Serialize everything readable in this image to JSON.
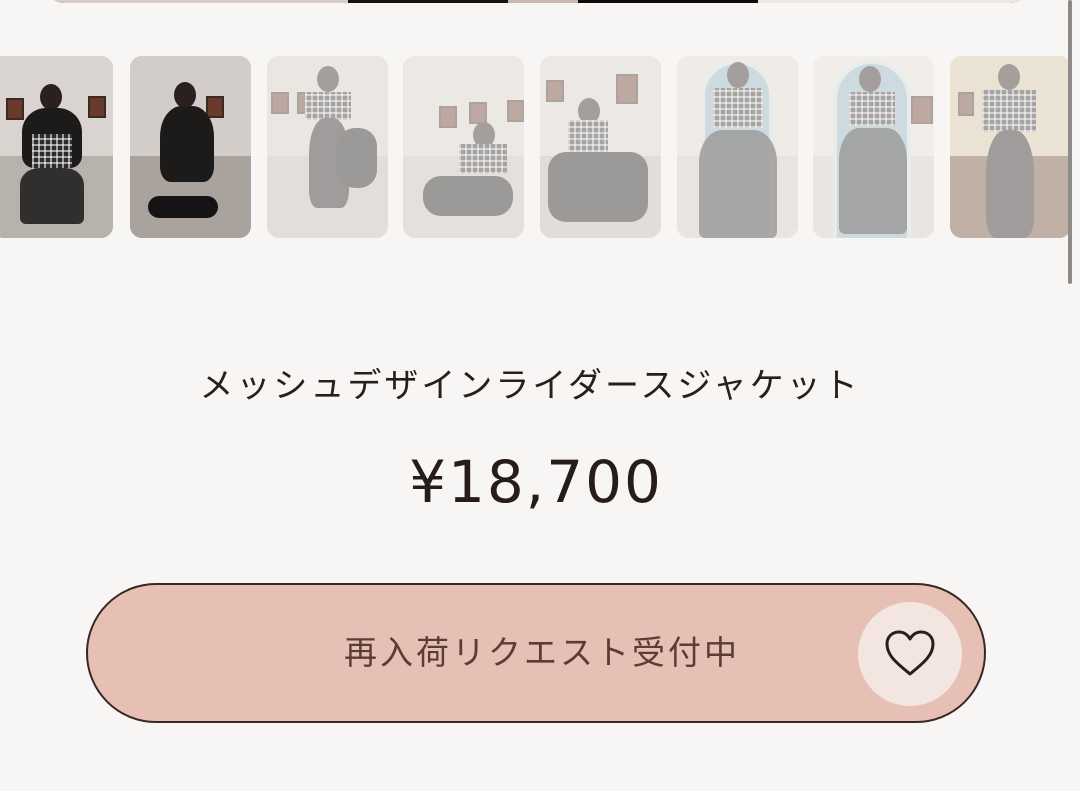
{
  "gallery": {
    "thumbnails": [
      {
        "id": "t1",
        "style": "studio-black-skirt"
      },
      {
        "id": "t2",
        "style": "studio-bag-pose"
      },
      {
        "id": "t3",
        "style": "studio-standing"
      },
      {
        "id": "t4",
        "style": "studio-lounge-chair"
      },
      {
        "id": "t5",
        "style": "studio-sitting-chair"
      },
      {
        "id": "t6",
        "style": "blue-door-tulle-skirt"
      },
      {
        "id": "t7",
        "style": "blue-door-tulle-skirt-full"
      },
      {
        "id": "t8",
        "style": "wood-room-shorts"
      }
    ]
  },
  "product": {
    "name": "メッシュデザインライダースジャケット",
    "price": "¥18,700"
  },
  "actions": {
    "restock_label": "再入荷リクエスト受付中",
    "favorite_icon": "heart-outline-icon"
  },
  "colors": {
    "background": "#f8f6f4",
    "button_fill": "#e6c0b4",
    "button_border": "#3a2624",
    "favorite_bg": "#f3e6e1",
    "text": "#2a1e1c"
  }
}
